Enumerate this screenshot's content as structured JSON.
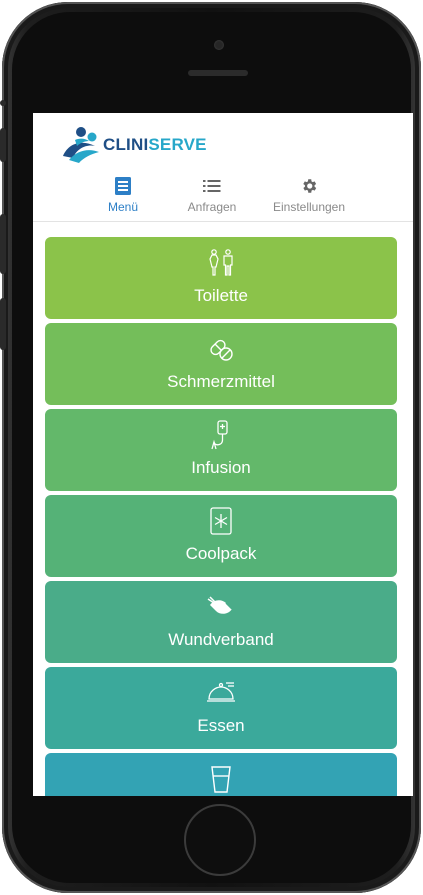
{
  "app": {
    "logo_left": "CLINI",
    "logo_right": "SERVE"
  },
  "nav": {
    "tabs": [
      {
        "label": "Menü",
        "icon": "menu-doc-icon",
        "active": true
      },
      {
        "label": "Anfragen",
        "icon": "list-icon",
        "active": false
      },
      {
        "label": "Einstellungen",
        "icon": "gear-icon",
        "active": false
      }
    ]
  },
  "menu": {
    "items": [
      {
        "label": "Toilette",
        "icon": "toilet-people-icon",
        "color": "#8bc34a"
      },
      {
        "label": "Schmerzmittel",
        "icon": "pill-icon",
        "color": "#74be5a"
      },
      {
        "label": "Infusion",
        "icon": "iv-drip-icon",
        "color": "#63b86a"
      },
      {
        "label": "Coolpack",
        "icon": "snowflake-icon",
        "color": "#55b277"
      },
      {
        "label": "Wundverband",
        "icon": "bandage-icon",
        "color": "#4aac89"
      },
      {
        "label": "Essen",
        "icon": "food-cloche-icon",
        "color": "#3ba99b"
      },
      {
        "label": "",
        "icon": "water-glass-icon",
        "color": "#33a3b4"
      }
    ]
  },
  "colors": {
    "accent": "#2d7fc6",
    "logo_dark": "#1f4f86",
    "logo_light": "#27a7c9"
  }
}
